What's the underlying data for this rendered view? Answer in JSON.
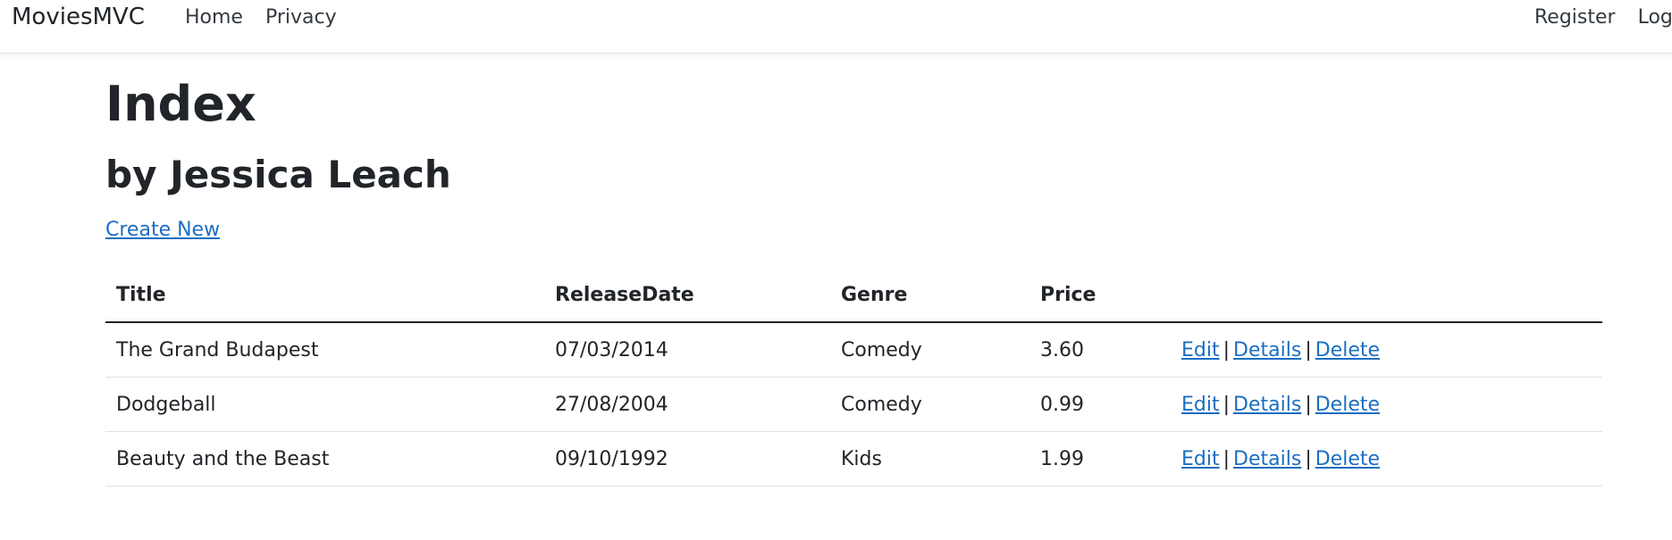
{
  "navbar": {
    "brand": "MoviesMVC",
    "left_links": [
      "Home",
      "Privacy"
    ],
    "right_links": [
      "Register",
      "Login"
    ]
  },
  "page": {
    "title": "Index",
    "subtitle": "by Jessica Leach",
    "create_link": "Create New"
  },
  "table": {
    "headers": [
      "Title",
      "ReleaseDate",
      "Genre",
      "Price"
    ],
    "rows": [
      {
        "title": "The Grand Budapest",
        "release_date": "07/03/2014",
        "genre": "Comedy",
        "price": "3.60"
      },
      {
        "title": "Dodgeball",
        "release_date": "27/08/2004",
        "genre": "Comedy",
        "price": "0.99"
      },
      {
        "title": "Beauty and the Beast",
        "release_date": "09/10/1992",
        "genre": "Kids",
        "price": "1.99"
      }
    ],
    "actions": {
      "edit": "Edit",
      "details": "Details",
      "delete": "Delete",
      "separator": "|"
    }
  },
  "colors": {
    "link": "#1b6ec2",
    "text": "#212529"
  }
}
